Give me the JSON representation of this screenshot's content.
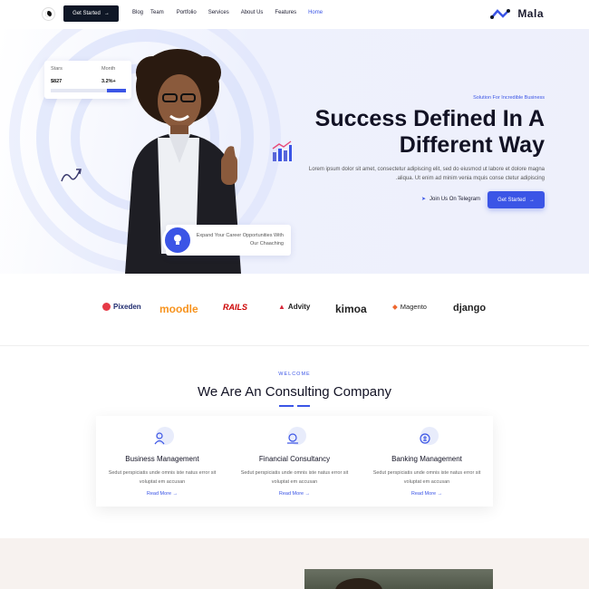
{
  "header": {
    "cta_label": "Get Started",
    "nav": [
      "Blog",
      "Team",
      "Portfolio",
      "Services",
      "About Us",
      "Features",
      "Home"
    ],
    "logo_text": "Mala"
  },
  "hero": {
    "stats": {
      "left_label": "Stars",
      "left_value": "$827",
      "right_label": "Month",
      "right_value": "3.2%+",
      "progress": 0.25
    },
    "coach_text": "Expand Your Career Opportunities With Our Chaaching",
    "subtitle": "Solution For Incredible Business",
    "title_line1": "Success Defined In A",
    "title_line2": "Different Way",
    "description": "Lorem ipsum dolor sit amet, consectetur adipiscing elit, sed do eiusmod ut labore et dolore magna .aliqua. Ut enim ad minim venia mquis conse ctetur adipiscing",
    "telegram_label": "Join Us On Telegram",
    "cta_label": "Get Started"
  },
  "brands": [
    "Pixeden",
    "moodle",
    "RAILS",
    "Advity",
    "kimoa",
    "Magento",
    "django"
  ],
  "welcome": {
    "eyebrow": "WELCOME",
    "title": "We Are An Consulting Company"
  },
  "cards": [
    {
      "title": "Business Management",
      "text": "Sedut perspiciatis unde omnis iste natus error sit voluptat em accusan",
      "link": "Read More"
    },
    {
      "title": "Financial Consultancy",
      "text": "Sedut perspiciatis unde omnis iste natus error sit voluptat em accusan",
      "link": "Read More"
    },
    {
      "title": "Banking Management",
      "text": "Sedut perspiciatis unde omnis iste natus error sit voluptat em accusan",
      "link": "Read More"
    }
  ],
  "colors": {
    "accent": "#3b55e6",
    "dark": "#0f1726"
  }
}
